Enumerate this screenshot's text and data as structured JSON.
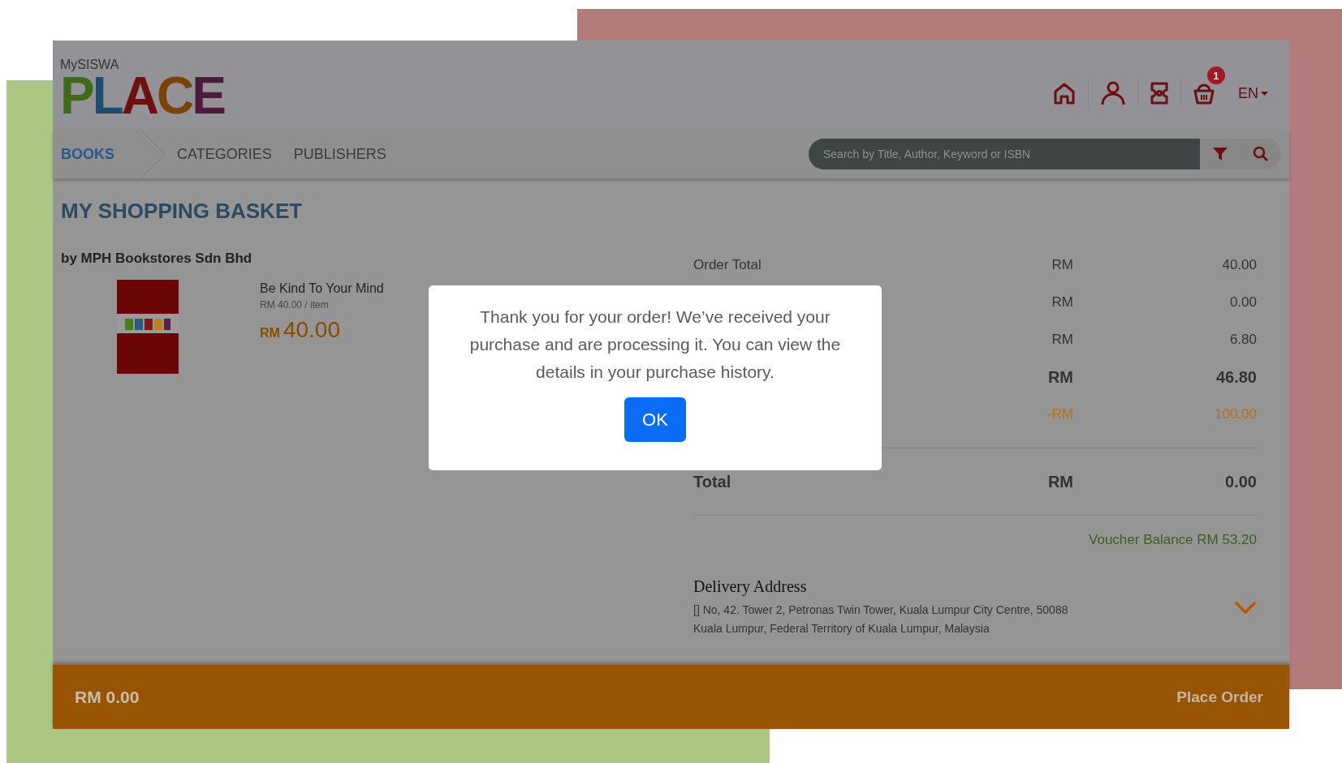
{
  "header": {
    "logo": {
      "small_text": "MySISWA",
      "big_text": "PLACE"
    },
    "cart_badge": "1",
    "language": "EN"
  },
  "nav": {
    "tabs": [
      {
        "label": "BOOKS",
        "selected": true
      },
      {
        "label": "CATEGORIES",
        "selected": false
      },
      {
        "label": "PUBLISHERS",
        "selected": false
      }
    ],
    "search": {
      "placeholder": "Search by Title, Author, Keyword or ISBN"
    }
  },
  "page_title": "MY SHOPPING BASKET",
  "seller": "by MPH Bookstores Sdn Bhd",
  "items": [
    {
      "title": "Be Kind To Your Mind",
      "unit_price": "RM 40.00 / item",
      "currency": "RM",
      "price": "40.00"
    }
  ],
  "summary": {
    "rows": [
      {
        "kind": "normal",
        "label": "Order Total",
        "currency": "RM",
        "amount": "40.00"
      },
      {
        "kind": "normal",
        "currency": "RM",
        "amount": "0.00"
      },
      {
        "kind": "normal",
        "currency": "RM",
        "amount": "6.80"
      },
      {
        "kind": "bold",
        "currency": "RM",
        "amount": "46.80"
      },
      {
        "kind": "discount",
        "currency": "-RM",
        "amount": "100.00"
      }
    ],
    "total": {
      "label": "Total",
      "currency": "RM",
      "amount": "0.00"
    },
    "voucher_balance": "Voucher Balance RM 53.20"
  },
  "delivery": {
    "title": "Delivery Address",
    "lines": [
      "[] No, 42. Tower 2, Petronas Twin Tower, Kuala Lumpur City Centre, 50088",
      "Kuala Lumpur, Federal Territory of Kuala Lumpur, Malaysia"
    ]
  },
  "footer": {
    "amount": "RM 0.00",
    "button": "Place Order"
  },
  "dialog": {
    "message": "Thank you for your order! We’ve received your purchase and are processing it. You can view the details in your purchase history.",
    "button": "OK"
  }
}
